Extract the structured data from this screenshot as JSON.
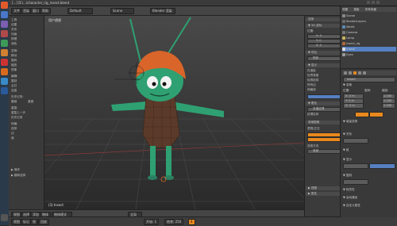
{
  "window": {
    "title": "[...] D:\\...\\character_rig_insect.blend"
  },
  "menubar": {
    "items": [
      "文件",
      "渲染",
      "窗口",
      "帮助"
    ],
    "layout_name": "Default",
    "scene_name": "Scene",
    "engine": "Blender 渲染"
  },
  "left_panel": {
    "tabs": [
      "工具",
      "创建",
      "关系",
      "动画",
      "物理",
      "润色"
    ],
    "items": [
      "变换:",
      "移动",
      "旋转",
      "缩放",
      "镜像",
      "编辑:",
      "复制",
      "合并",
      "连接",
      "历史记录:",
      "撤销",
      "重做",
      "重复:",
      "重复上一步",
      "历史记录",
      "网格:",
      "选择",
      "边",
      "面"
    ],
    "footer": [
      "▶ 操作",
      "▶ 翻转选择"
    ]
  },
  "viewport": {
    "label": "用户透视",
    "footer_label": "(3) Insect"
  },
  "bottom_bar": {
    "items": [
      "视图",
      "选择",
      "添加",
      "物体",
      "物体模式",
      "全局"
    ]
  },
  "timeline": {
    "items": [
      "视图",
      "标记",
      "帧",
      "回放",
      "开始: 1",
      "结束: 250",
      "4"
    ]
  },
  "mid_panel": {
    "rows": [
      "变换",
      "▼ 3D 游标",
      "位置:",
      "X: 0",
      "Y: 0",
      "Z: 0",
      "▼ 项目",
      "物体",
      "▼ 显示",
      "仅渲染",
      "世界背景",
      "轮廓选择",
      "所有边",
      "网格线",
      "▼ 着色",
      "多重纹理",
      "纹理实体",
      "背景图像",
      "透视/正交",
      "变换方向",
      "局部",
      "▶ 视图",
      "▶ 属性"
    ]
  },
  "outliner": {
    "header": [
      "视图",
      "搜索",
      "所有场景"
    ],
    "rows": [
      "Scene",
      "RenderLayers",
      "World",
      "Camera",
      "Lamp",
      "insect_rig",
      "Insect",
      "Eyes"
    ]
  },
  "properties": {
    "object_name": "Insect",
    "sections": [
      "▼ 变换",
      "位置:",
      "旋转:",
      "缩放:",
      "▼ 增量变换",
      "▼ 关系",
      "▼ 组",
      "▼ 显示",
      "▼ 复制",
      "▼ 相关性",
      "▼ 运动路径",
      "▼ 自定义属性"
    ],
    "fields": [
      "X: 0 m",
      "Y: 0 m",
      "Z: 0 m",
      "1.000",
      "1.000",
      "1.000"
    ]
  },
  "colors": {
    "accent_orange": "#e8891e",
    "accent_blue": "#5680c2",
    "char_green": "#2fa072",
    "char_orange": "#d9652a",
    "mesh_brown": "#5c3a2a"
  }
}
